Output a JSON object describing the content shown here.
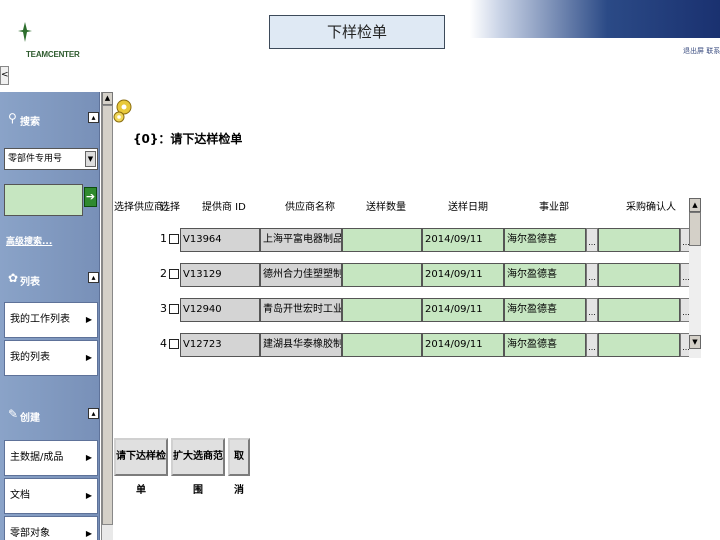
{
  "header": {
    "title": "下样检单",
    "logo_text": "TEAMCENTER",
    "user_links": "退出屏  联系我",
    "back_symbol": "<"
  },
  "sidebar": {
    "search_section": {
      "label": "搜索",
      "toggle": "▴"
    },
    "search_type": {
      "value": "零部件专用号"
    },
    "search_input": {
      "value": ""
    },
    "go_symbol": "➔",
    "advanced_search": "高级搜索...",
    "list_section": {
      "label": "列表",
      "toggle": "▴"
    },
    "list_items": [
      {
        "label": "我的工作列表"
      },
      {
        "label": "我的列表"
      }
    ],
    "create_section": {
      "label": "创建",
      "toggle": "▴"
    },
    "create_items": [
      {
        "label": "主数据/成品"
      },
      {
        "label": "文档"
      },
      {
        "label": "零部对象"
      }
    ]
  },
  "content": {
    "heading": "{0}：请下达样检单",
    "columns": {
      "select_supplier": "选择供应商：",
      "select": "选择",
      "supplier_id": "提供商 ID",
      "supplier_name": "供应商名称",
      "sample_qty": "送样数量",
      "sample_date": "送样日期",
      "business_unit": "事业部",
      "purchase_confirm": "采购确认人"
    },
    "rows": [
      {
        "num": "1",
        "supplier_id": "V13964",
        "supplier_name": "上海平富电器制品有限公司",
        "qty": "",
        "date": "2014/09/11",
        "unit": "海尔盈德喜",
        "confirm": ""
      },
      {
        "num": "2",
        "supplier_id": "V13129",
        "supplier_name": "德州合力佳塑塑制品有限公司",
        "qty": "",
        "date": "2014/09/11",
        "unit": "海尔盈德喜",
        "confirm": ""
      },
      {
        "num": "3",
        "supplier_id": "V12940",
        "supplier_name": "青岛开世宏时工业有限公司",
        "qty": "",
        "date": "2014/09/11",
        "unit": "海尔盈德喜",
        "confirm": ""
      },
      {
        "num": "4",
        "supplier_id": "V12723",
        "supplier_name": "建湖县华泰橡胶制品有限公司",
        "qty": "",
        "date": "2014/09/11",
        "unit": "海尔盈德喜",
        "confirm": ""
      }
    ],
    "ellipsis": "...",
    "buttons": {
      "issue": "请下达样检单",
      "expand": "扩大选商范围",
      "cancel": "取消"
    }
  },
  "colors": {
    "sidebar_bg": "#7890b8",
    "input_green": "#c6e6c1",
    "cell_gray": "#d4d4d4",
    "title_box": "#dfe9f4",
    "banner_dark": "#1a3170"
  }
}
